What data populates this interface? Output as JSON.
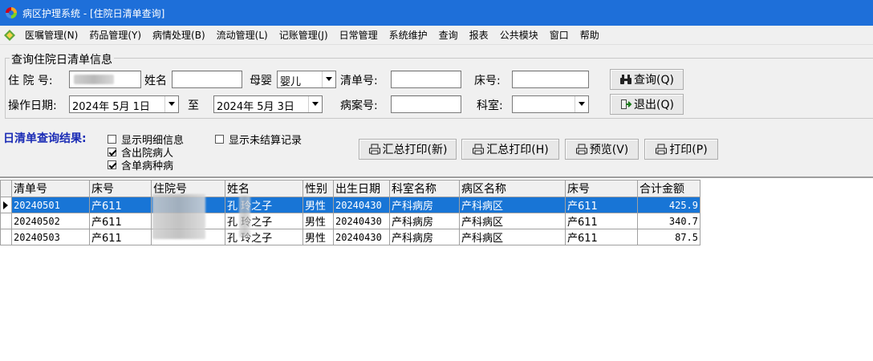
{
  "window": {
    "title": "病区护理系统 - [住院日清单查询]"
  },
  "menu": [
    "医嘱管理(N)",
    "药品管理(Y)",
    "病情处理(B)",
    "流动管理(L)",
    "记账管理(J)",
    "日常管理",
    "系统维护",
    "查询",
    "报表",
    "公共模块",
    "窗口",
    "帮助"
  ],
  "query": {
    "group_title": "查询住院日清单信息",
    "inpatient_no_label": "住 院 号:",
    "inpatient_no_value": "",
    "name_label": "姓名",
    "name_value": "",
    "mother_baby_label": "母婴",
    "mother_baby_value": "婴儿",
    "bill_no_label": "清单号:",
    "bill_no_value": "",
    "bed_no_label": "床号:",
    "bed_no_value": "",
    "op_date_label": "操作日期:",
    "date_from": "2024年 5月 1日",
    "date_to_label": "至",
    "date_to": "2024年 5月 3日",
    "case_no_label": "病案号:",
    "case_no_value": "",
    "dept_label": "科室:",
    "dept_value": "",
    "search_button": "查询(Q)",
    "exit_button": "退出(Q)"
  },
  "results": {
    "label": "日清单查询结果:",
    "show_detail": {
      "label": "显示明细信息",
      "checked": false
    },
    "include_discharged": {
      "label": "含出院病人",
      "checked": true
    },
    "include_single_disease": {
      "label": "含单病种病",
      "checked": true
    },
    "show_unsettled": {
      "label": "显示未结算记录",
      "checked": false
    },
    "buttons": {
      "summary_print_new": "汇总打印(新)",
      "summary_print": "汇总打印(H)",
      "preview": "预览(V)",
      "print": "打印(P)"
    }
  },
  "grid": {
    "columns": [
      "清单号",
      "床号",
      "住院号",
      "姓名",
      "性别",
      "出生日期",
      "科室名称",
      "病区名称",
      "床号",
      "合计金额"
    ],
    "rows": [
      [
        "20240501",
        "产611",
        "",
        "孔 玲之子",
        "男性",
        "20240430",
        "产科病房",
        "产科病区",
        "产611",
        "425.9"
      ],
      [
        "20240502",
        "产611",
        "",
        "孔 玲之子",
        "男性",
        "20240430",
        "产科病房",
        "产科病区",
        "产611",
        "340.7"
      ],
      [
        "20240503",
        "产611",
        "",
        "孔 玲之子",
        "男性",
        "20240430",
        "产科病房",
        "产科病区",
        "产611",
        "87.5"
      ]
    ],
    "selected_row": 0
  }
}
